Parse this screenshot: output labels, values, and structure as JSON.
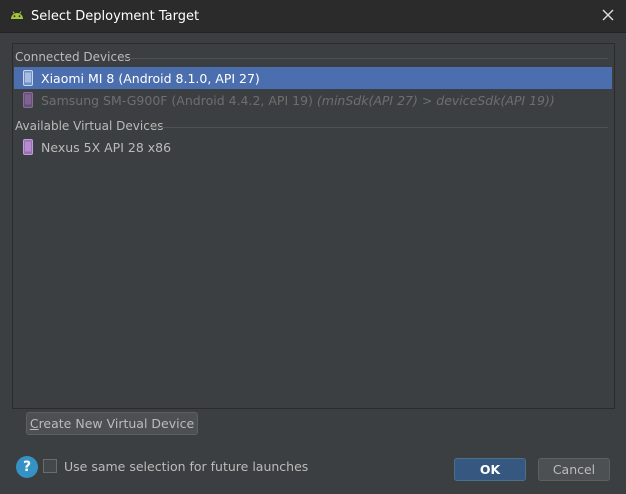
{
  "window": {
    "title": "Select Deployment Target",
    "icon": "android-icon",
    "close_icon": "close-icon"
  },
  "groups": {
    "connected": {
      "label": "Connected Devices",
      "devices": [
        {
          "name": "Xiaomi MI 8 (Android 8.1.0, API 27)",
          "warning": "",
          "state": "selected",
          "icon": "phone-icon"
        },
        {
          "name": "Samsung SM-G900F (Android 4.4.2, API 19)",
          "warning": "(minSdk(API 27) > deviceSdk(API 19))",
          "state": "disabled",
          "icon": "phone-icon"
        }
      ]
    },
    "virtual": {
      "label": "Available Virtual Devices",
      "devices": [
        {
          "name": "Nexus 5X API 28 x86",
          "warning": "",
          "state": "normal",
          "icon": "phone-icon"
        }
      ]
    }
  },
  "buttons": {
    "create_mnemonic": "C",
    "create_rest": "reate New Virtual Device",
    "ok": "OK",
    "cancel": "Cancel",
    "help": "?"
  },
  "options": {
    "same_selection_label": "Use same selection for future launches",
    "same_selection_checked": false
  },
  "colors": {
    "background": "#3c3f41",
    "titlebar": "#2b2b2b",
    "selection": "#4b6eaf",
    "ok_button": "#365880",
    "help_icon": "#3592c4",
    "android_green": "#a4c639"
  }
}
